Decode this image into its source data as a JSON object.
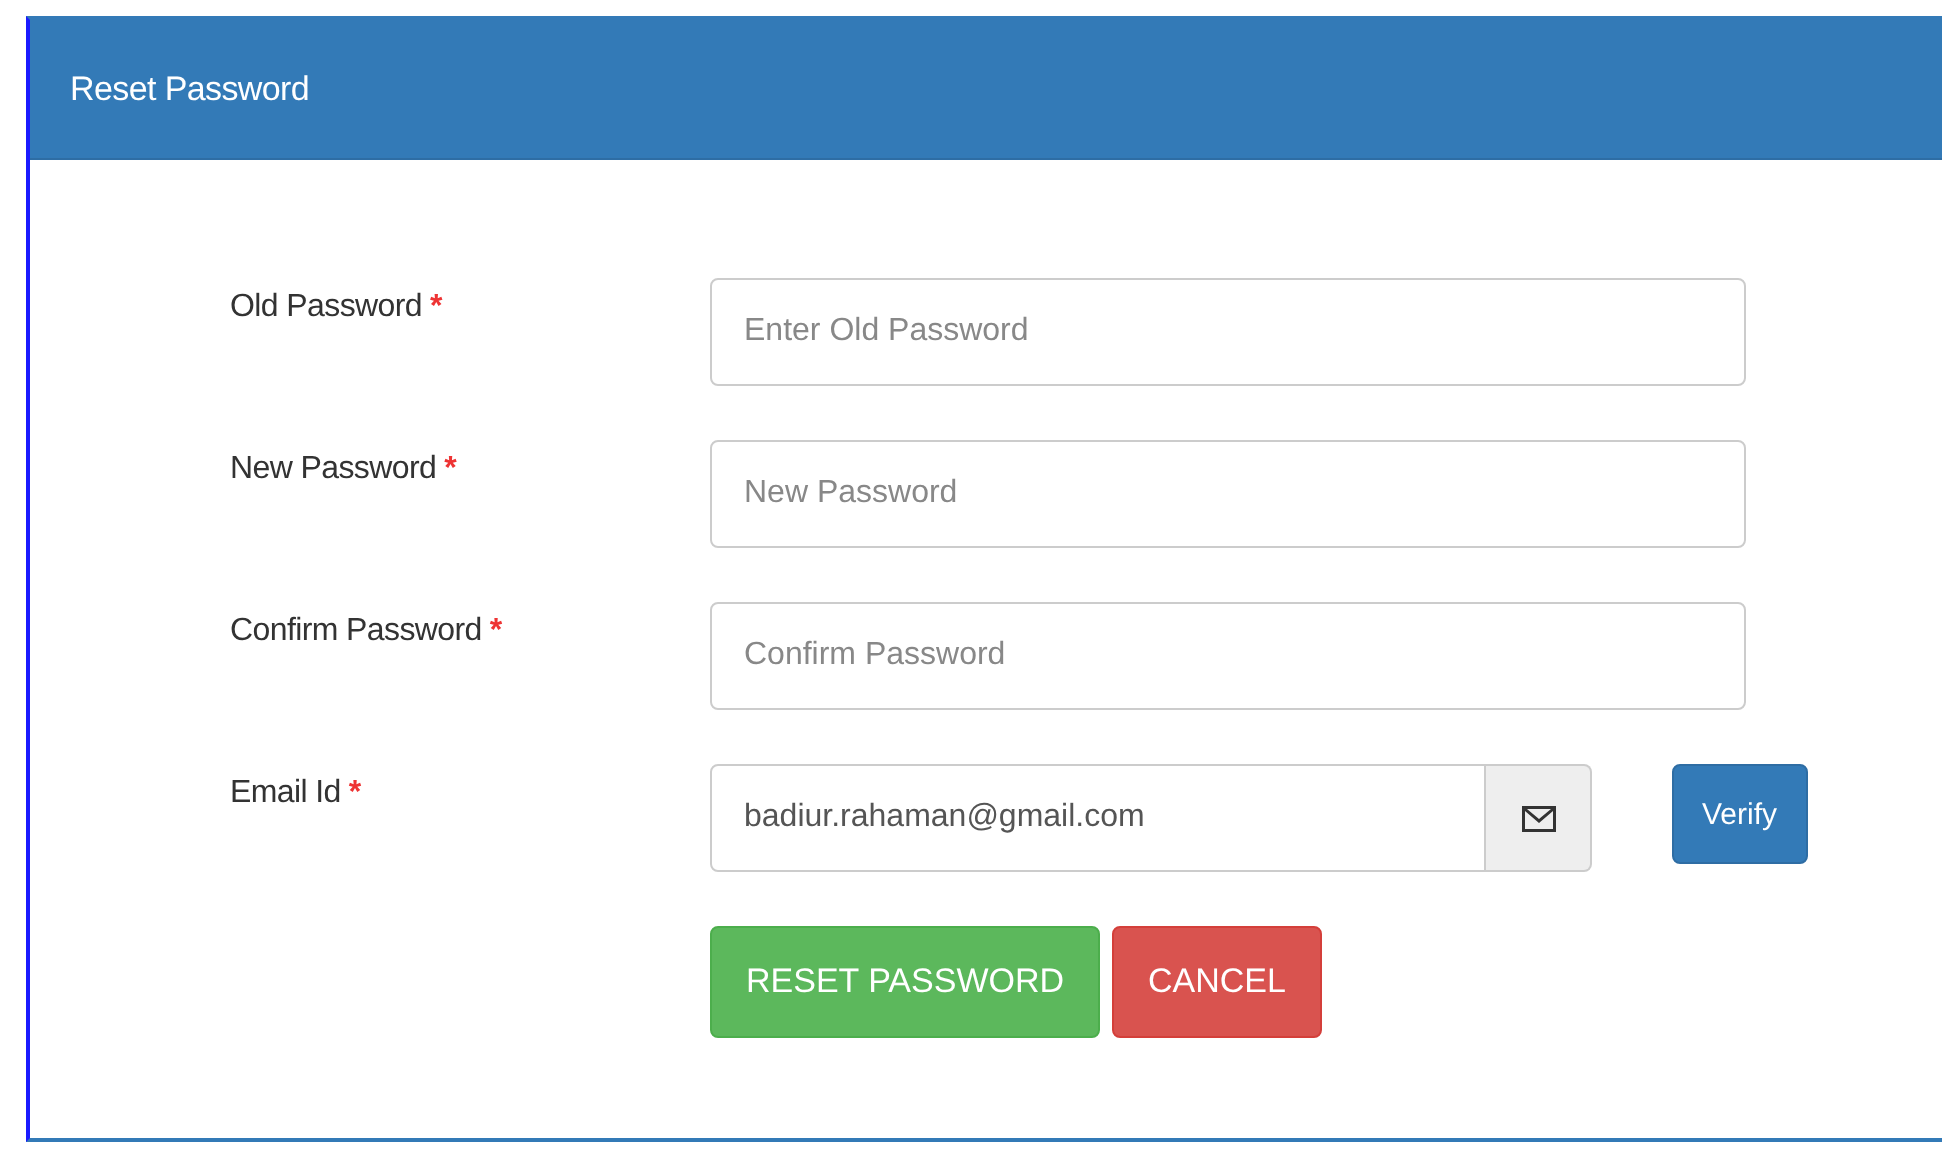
{
  "panel": {
    "title": "Reset Password"
  },
  "fields": [
    {
      "kind": "text",
      "label": "Old Password",
      "required_mark": "*",
      "placeholder": "Enter Old Password"
    },
    {
      "kind": "text",
      "label": "New Password",
      "required_mark": "*",
      "placeholder": "New Password"
    },
    {
      "kind": "text",
      "label": "Confirm Password",
      "required_mark": "*",
      "placeholder": "Confirm Password"
    },
    {
      "kind": "email",
      "label": "Email Id",
      "required_mark": "*",
      "value": "badiur.rahaman@gmail.com",
      "action": "Verify"
    }
  ],
  "buttons": [
    {
      "kind": "success",
      "label": "RESET PASSWORD"
    },
    {
      "kind": "danger",
      "label": "CANCEL"
    }
  ]
}
